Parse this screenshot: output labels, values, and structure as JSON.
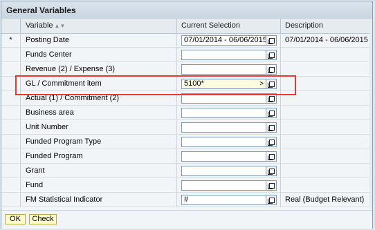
{
  "title": "General Variables",
  "columns": {
    "variable": "Variable",
    "selection": "Current Selection",
    "description": "Description"
  },
  "rows": [
    {
      "marker": "*",
      "variable": "Posting Date",
      "value": "07/01/2014 - 06/06/2015",
      "description": "07/01/2014 - 06/06/2015"
    },
    {
      "marker": "",
      "variable": "Funds Center",
      "value": "",
      "description": ""
    },
    {
      "marker": "",
      "variable": "Revenue (2) / Expense (3)",
      "value": "",
      "description": ""
    },
    {
      "marker": "",
      "variable": "GL / Commitment item",
      "value": "5100*",
      "description": ""
    },
    {
      "marker": "",
      "variable": "Actual (1) / Commitment (2)",
      "value": "",
      "description": ""
    },
    {
      "marker": "",
      "variable": "Business area",
      "value": "",
      "description": ""
    },
    {
      "marker": "",
      "variable": "Unit Number",
      "value": "",
      "description": ""
    },
    {
      "marker": "",
      "variable": "Funded Program Type",
      "value": "",
      "description": ""
    },
    {
      "marker": "",
      "variable": "Funded Program",
      "value": "",
      "description": ""
    },
    {
      "marker": "",
      "variable": "Grant",
      "value": "",
      "description": ""
    },
    {
      "marker": "",
      "variable": "Fund",
      "value": "",
      "description": ""
    },
    {
      "marker": "",
      "variable": "FM Statistical Indicator",
      "value": "#",
      "description": "Real (Budget Relevant)"
    }
  ],
  "buttons": {
    "ok": "OK",
    "check": "Check"
  },
  "colors": {
    "highlight": "#e53935",
    "accent": "#fffbd0"
  }
}
